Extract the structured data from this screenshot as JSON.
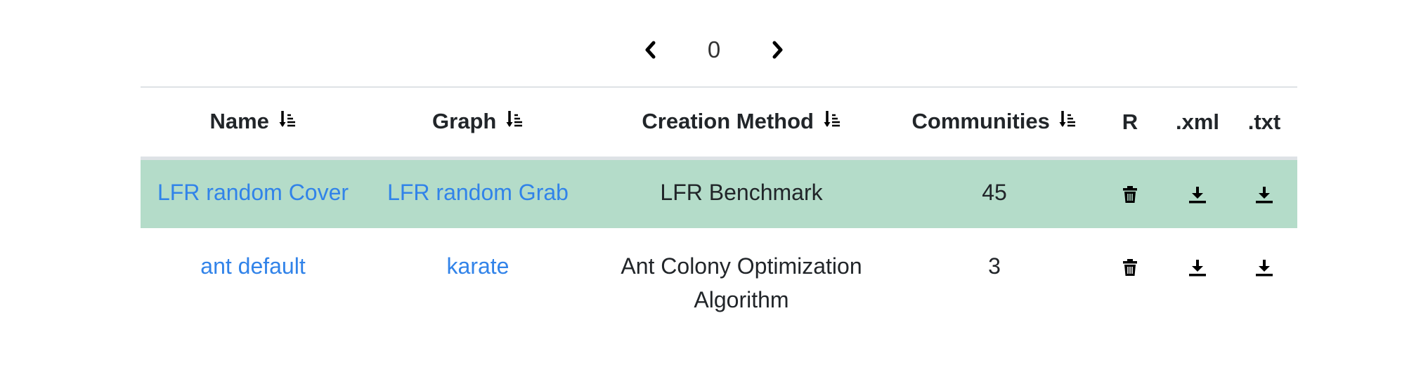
{
  "pagination": {
    "current_page": "0",
    "prev_icon": "chevron-left-icon",
    "next_icon": "chevron-right-icon"
  },
  "table": {
    "headers": {
      "name": "Name",
      "graph": "Graph",
      "creation_method": "Creation Method",
      "communities": "Communities",
      "r": "R",
      "xml": ".xml",
      "txt": ".txt"
    },
    "sort_icon": "sort-descending-icon",
    "rows": [
      {
        "name": "LFR random Cover",
        "graph": "LFR random Grab",
        "creation_method": "LFR Benchmark",
        "communities": "45",
        "highlighted": true
      },
      {
        "name": "ant default",
        "graph": "karate",
        "creation_method": "Ant Colony Optimization Algorithm",
        "communities": "3",
        "highlighted": false
      }
    ],
    "row_icons": {
      "remove": "trash-icon",
      "xml": "download-icon",
      "txt": "download-icon"
    }
  },
  "colors": {
    "highlight_row": "#b4dcc9",
    "link": "#3183e9",
    "text": "#212529",
    "border": "#dee2e6"
  }
}
